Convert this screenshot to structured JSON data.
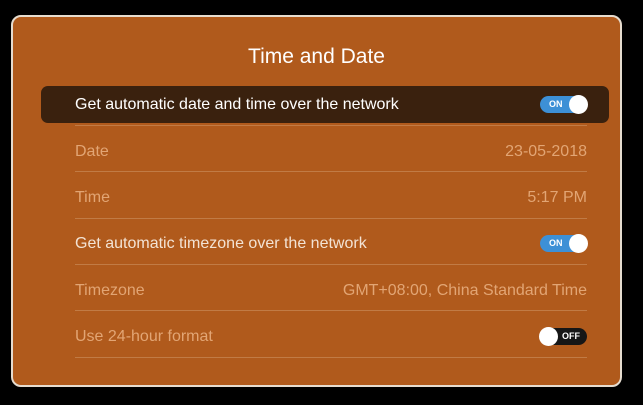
{
  "dialog": {
    "title": "Time and Date"
  },
  "settings": [
    {
      "label": "Get automatic date and time over the network",
      "toggle": "ON"
    },
    {
      "label": "Date",
      "value": "23-05-2018"
    },
    {
      "label": "Time",
      "value": "5:17 PM"
    },
    {
      "label": "Get automatic timezone over the network",
      "toggle": "ON"
    },
    {
      "label": "Timezone",
      "value": "GMT+08:00, China Standard Time"
    },
    {
      "label": "Use 24-hour format",
      "toggle": "OFF"
    }
  ],
  "colors": {
    "panel_background": "#b05a1c",
    "selected_row": "#3a210e",
    "toggle_on": "#3d90d6",
    "toggle_off": "#161616"
  }
}
